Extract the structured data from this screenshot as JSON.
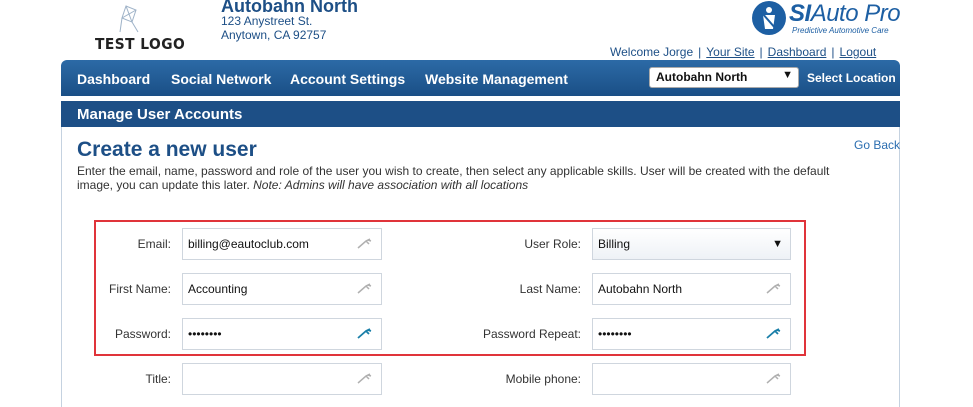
{
  "header": {
    "logo_text": "TEST LOGO",
    "shop_name": "Autobahn North",
    "address_line1": "123 Anystreet St.",
    "address_line2": "Anytown, CA 92757",
    "brand_prefix": "SI",
    "brand_suffix": "Auto Pro",
    "brand_tagline": "Predictive Automotive Care"
  },
  "user_nav": {
    "welcome": "Welcome Jorge",
    "links": [
      "Your Site",
      "Dashboard",
      "Logout"
    ],
    "separator": "|"
  },
  "navbar": {
    "items": [
      "Dashboard",
      "Social Network",
      "Account Settings",
      "Website Management"
    ],
    "location_selected": "Autobahn North",
    "select_location_label": "Select Location"
  },
  "page": {
    "section_title": "Manage User Accounts",
    "heading": "Create a new user",
    "go_back": "Go Back",
    "instructions": "Enter the email, name, password and role of the user you wish to create, then select any applicable skills. User will be created with the default image, you can update this later.",
    "note": "Note: Admins will have association with all locations"
  },
  "form": {
    "email_label": "Email:",
    "email_value": "billing@eautoclub.com",
    "first_name_label": "First Name:",
    "first_name_value": "Accounting",
    "password_label": "Password:",
    "password_value": "••••••••",
    "title_label": "Title:",
    "title_value": "",
    "user_role_label": "User Role:",
    "user_role_value": "Billing",
    "last_name_label": "Last Name:",
    "last_name_value": "Autobahn North",
    "password_repeat_label": "Password Repeat:",
    "password_repeat_value": "••••••••",
    "mobile_label": "Mobile phone:",
    "mobile_value": ""
  },
  "colors": {
    "brand_blue": "#1d4f86",
    "highlight_red": "#e0343a",
    "key_icon_active": "#1a7fa8",
    "key_icon_inactive": "#b0b0b0"
  }
}
